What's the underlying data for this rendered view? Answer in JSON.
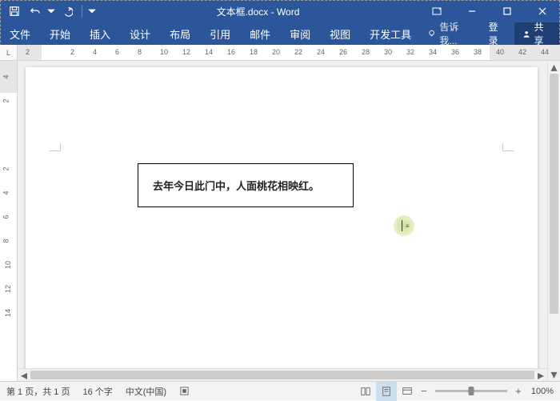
{
  "title": "文本框.docx - Word",
  "qat": {
    "save": "保存",
    "undo": "撤销",
    "redo": "重做"
  },
  "tabs": {
    "file": "文件",
    "home": "开始",
    "insert": "插入",
    "design": "设计",
    "layout": "布局",
    "references": "引用",
    "mailings": "邮件",
    "review": "审阅",
    "view": "视图",
    "developer": "开发工具"
  },
  "tell_me": "告诉我...",
  "login": "登录",
  "share": "共享",
  "ruler": {
    "h": [
      "2",
      "",
      "2",
      "4",
      "6",
      "8",
      "10",
      "12",
      "14",
      "16",
      "18",
      "20",
      "22",
      "24",
      "26",
      "28",
      "30",
      "32",
      "34",
      "36",
      "38",
      "40",
      "42",
      "44"
    ]
  },
  "textbox_content": "去年今日此门中，人面桃花相映红。",
  "status": {
    "page": "第 1 页，共 1 页",
    "words": "16 个字",
    "lang": "中文(中国)",
    "zoom": "100%"
  }
}
